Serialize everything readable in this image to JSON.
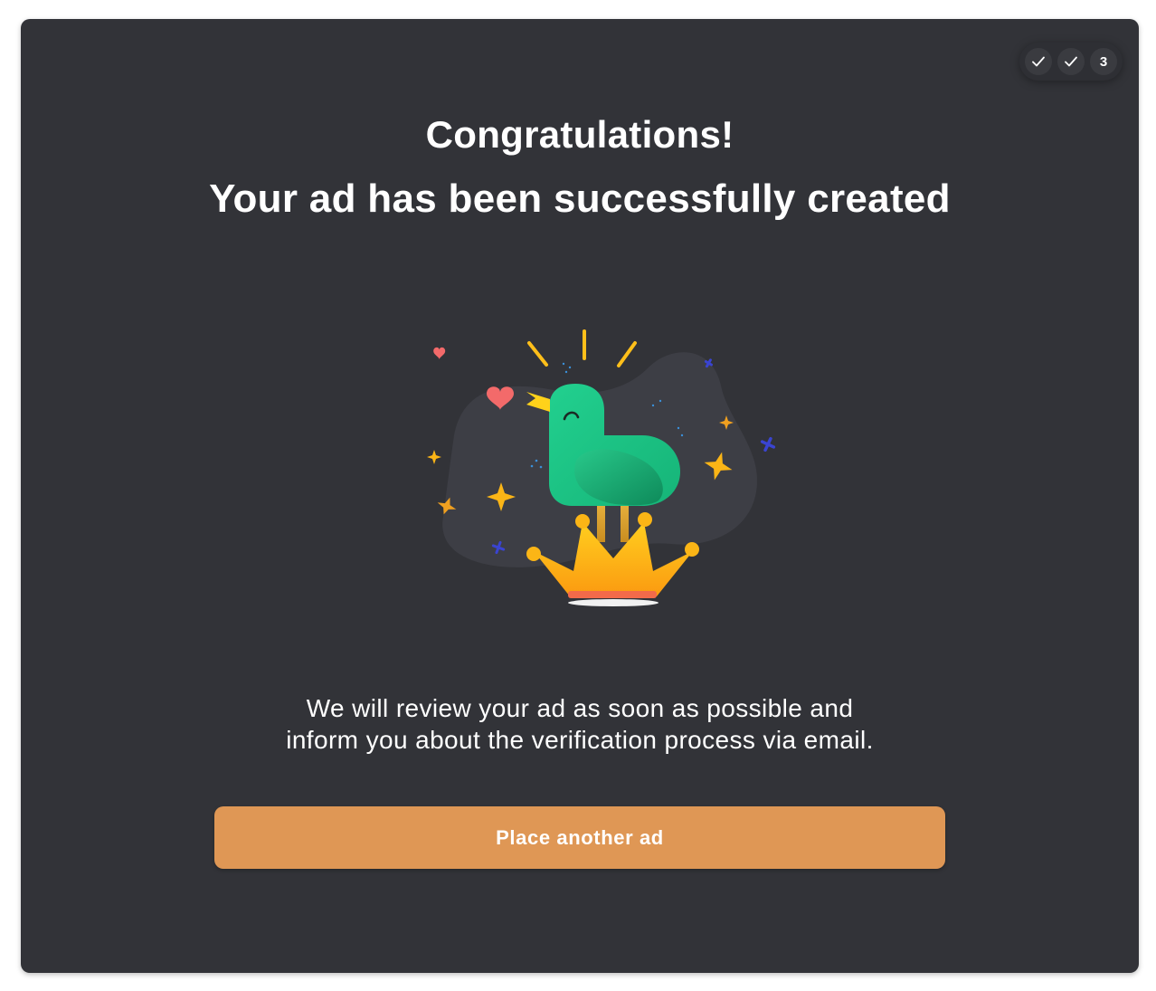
{
  "stepper": {
    "steps": [
      {
        "state": "completed",
        "icon": "check-icon",
        "label": ""
      },
      {
        "state": "completed",
        "icon": "check-icon",
        "label": ""
      },
      {
        "state": "current",
        "icon": "",
        "label": "3"
      }
    ]
  },
  "header": {
    "title": "Congratulations!",
    "subtitle": "Your ad has been successfully created"
  },
  "illustration": {
    "icon": "bird-on-crown-illustration"
  },
  "message": {
    "line1": "We will review your ad as soon as possible and",
    "line2": "inform you about the verification process via email."
  },
  "actions": {
    "place_another_ad": "Place another ad"
  },
  "colors": {
    "background": "#323338",
    "accent_button": "#df9755",
    "text": "#ffffff",
    "bird": "#1fc98a",
    "crown": "#fbb516"
  }
}
